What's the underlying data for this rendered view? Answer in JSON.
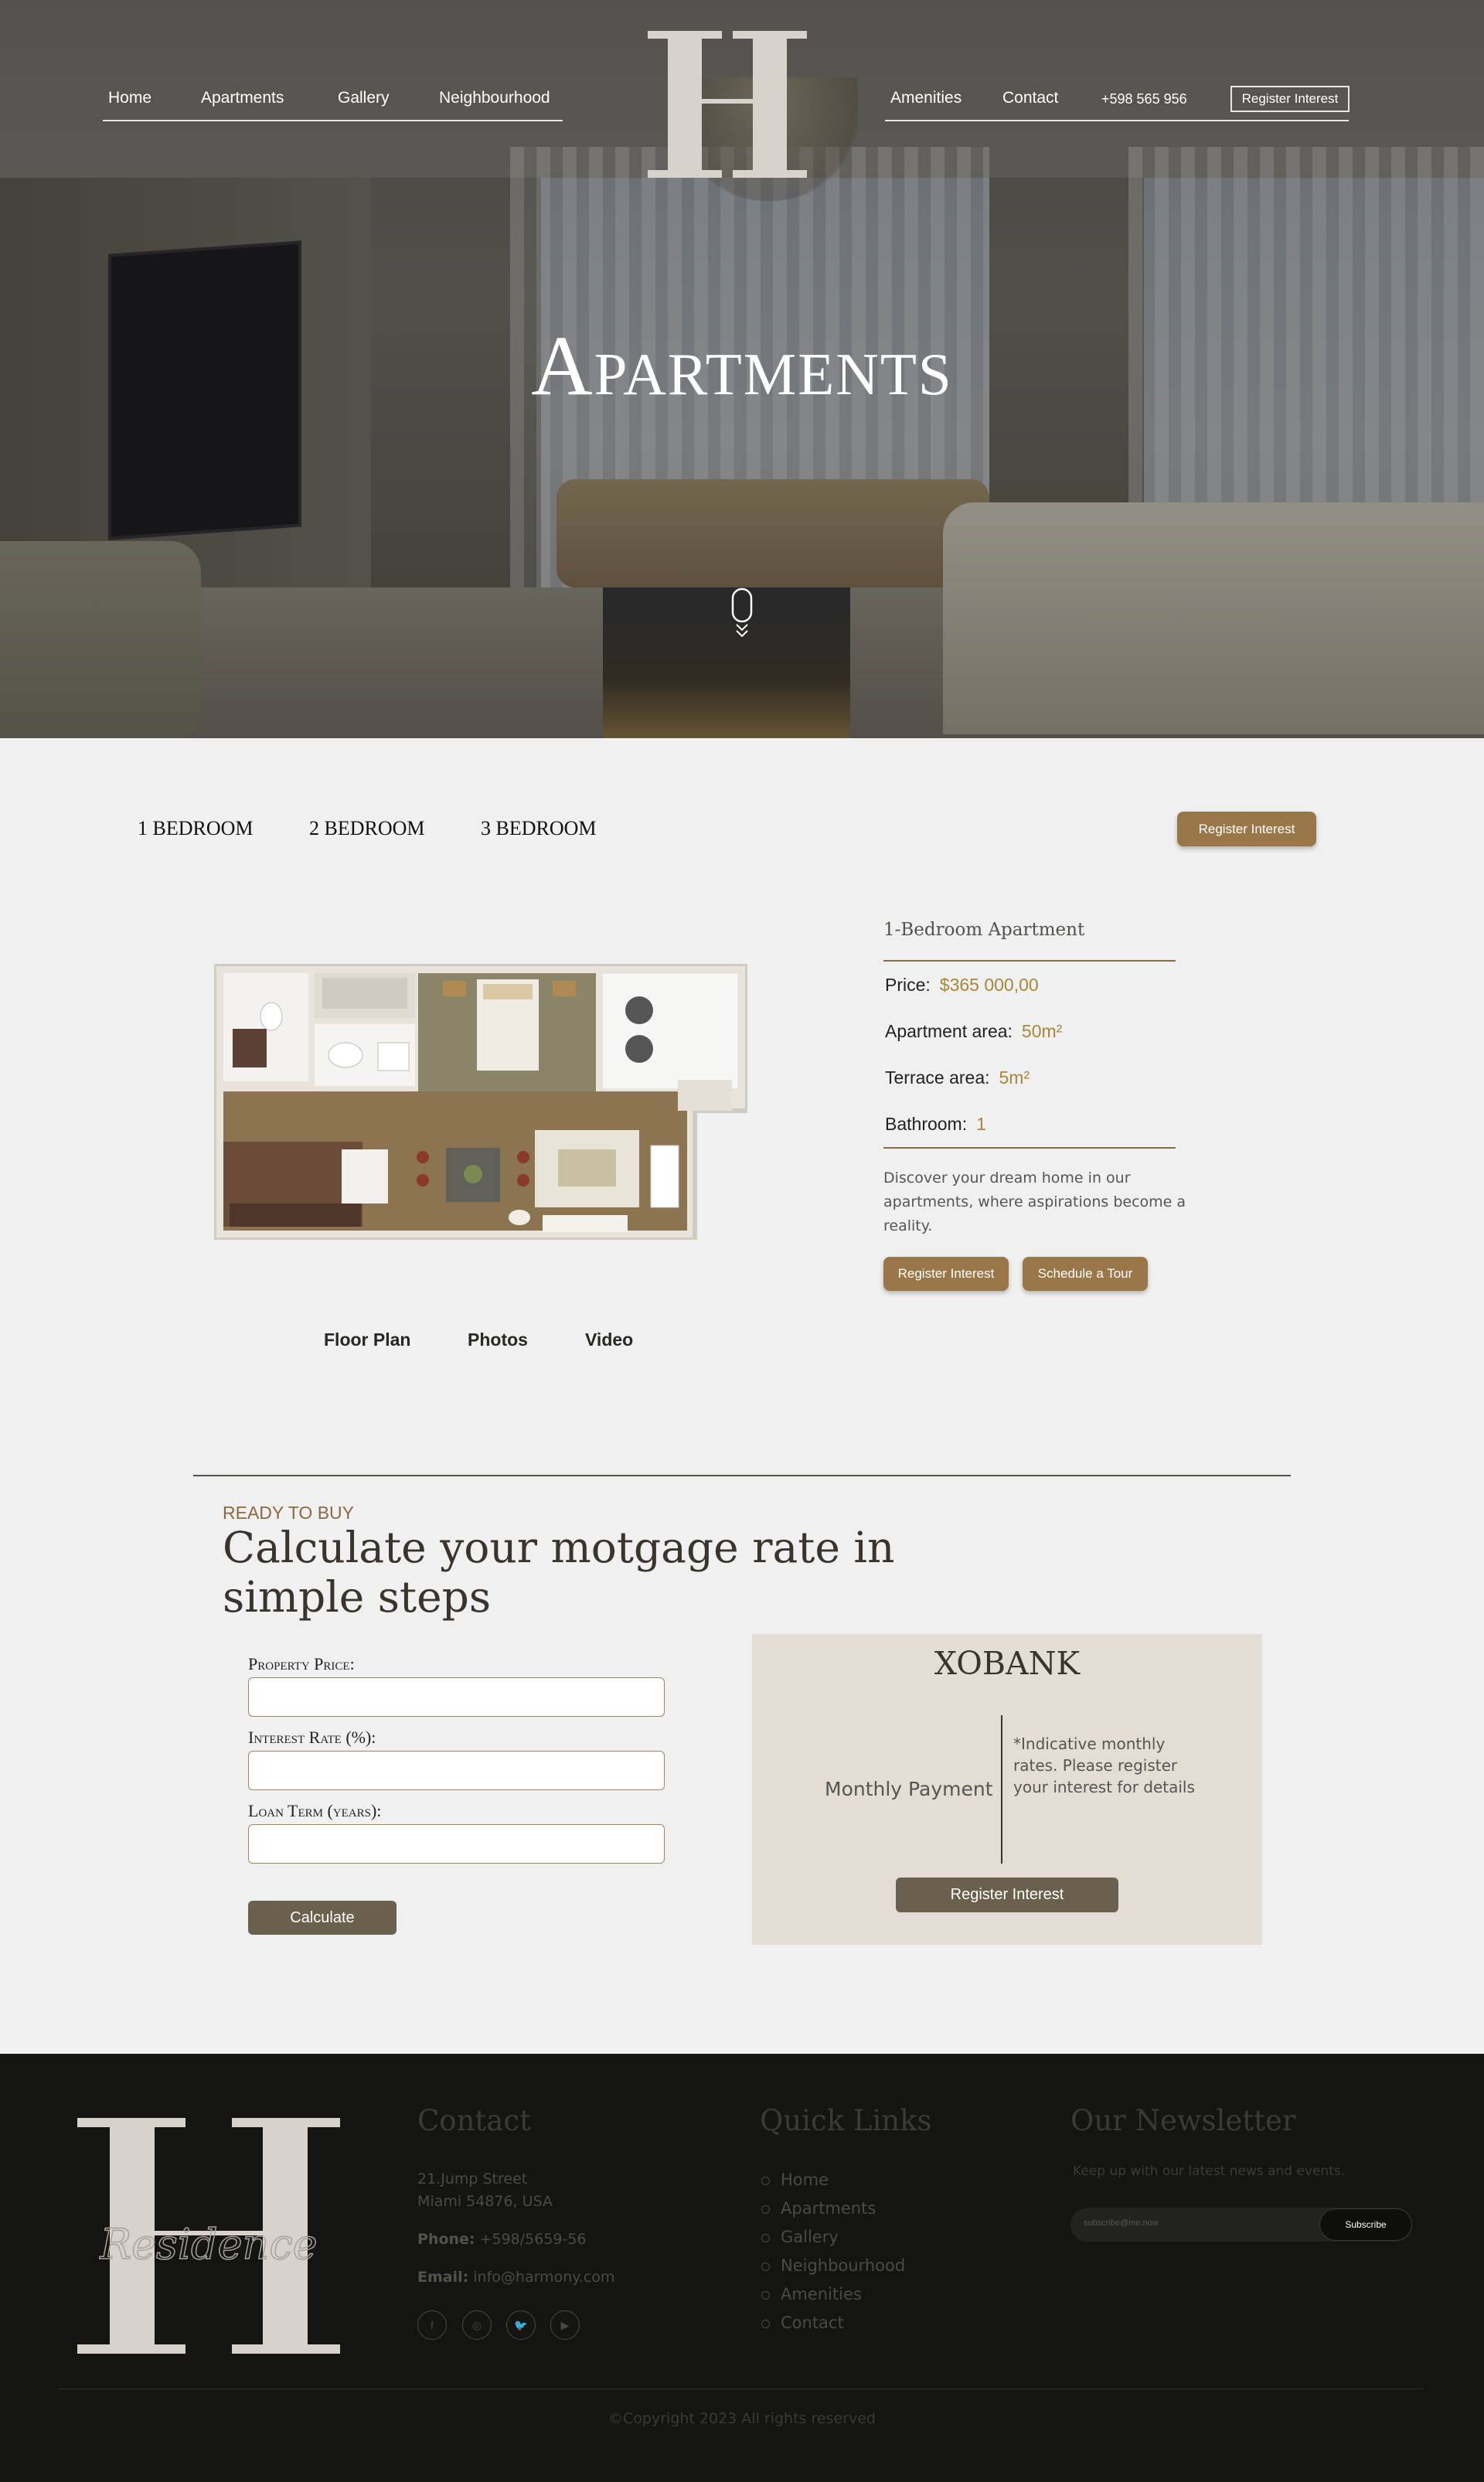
{
  "nav": {
    "left": [
      "Home",
      "Apartments",
      "Gallery",
      "Neighbourhood"
    ],
    "right": [
      "Amenities",
      "Contact"
    ],
    "phone": "+598 565 956",
    "register": "Register Interest"
  },
  "hero": {
    "title": "Apartments"
  },
  "tabs": [
    "1 BEDROOM",
    "2 BEDROOM",
    "3 BEDROOM"
  ],
  "register_button": "Register Interest",
  "apartment": {
    "title": "1-Bedroom Apartment",
    "price_label": "Price:",
    "price": "$365 000,00",
    "area_label": "Apartment area:",
    "area": "50m²",
    "terrace_label": "Terrace area:",
    "terrace": "5m²",
    "bathroom_label": "Bathroom:",
    "bathroom": "1",
    "description": "Discover your dream home in our apartments, where aspirations become a reality.",
    "register_btn": "Register Interest",
    "tour_btn": "Schedule a Tour"
  },
  "media_tabs": [
    "Floor Plan",
    "Photos",
    "Video"
  ],
  "mortgage": {
    "eyebrow": "READY TO BUY",
    "title": "Calculate your motgage rate in simple steps",
    "price_label": "Property Price:",
    "rate_label": "Interest Rate (%):",
    "term_label": "Loan Term (years):",
    "price_value": "",
    "rate_value": "",
    "term_value": "",
    "calculate": "Calculate"
  },
  "bank": {
    "name": "XOBANK",
    "monthly": "Monthly Payment",
    "note": "*Indicative monthly rates. Please register your interest for details",
    "register": "Register Interest"
  },
  "footer": {
    "logo_script": "Residence",
    "contact_title": "Contact",
    "address1": "21.Jump Street",
    "address2": "Miami 54876, USA",
    "phone_label": "Phone:",
    "phone": "+598/5659-56",
    "email_label": "Email:",
    "email": "info@harmony.com",
    "social": [
      "f",
      "◎",
      "🐦",
      "▶"
    ],
    "quick_title": "Quick Links",
    "links": [
      "Home",
      "Apartments",
      "Gallery",
      "Neighbourhood",
      "Amenities",
      "Contact"
    ],
    "news_title": "Our Newsletter",
    "news_desc": "Keep up with our latest news and events.",
    "news_placeholder": "subscribe@me.now",
    "news_btn": "Subscribe",
    "copyright": "©Copyright 2023 All rights reserved"
  },
  "colors": {
    "accent": "#9a7748",
    "dark_button": "#6b5f4e",
    "footer_bg": "#141412",
    "bank_box": "#e3ddd4"
  }
}
